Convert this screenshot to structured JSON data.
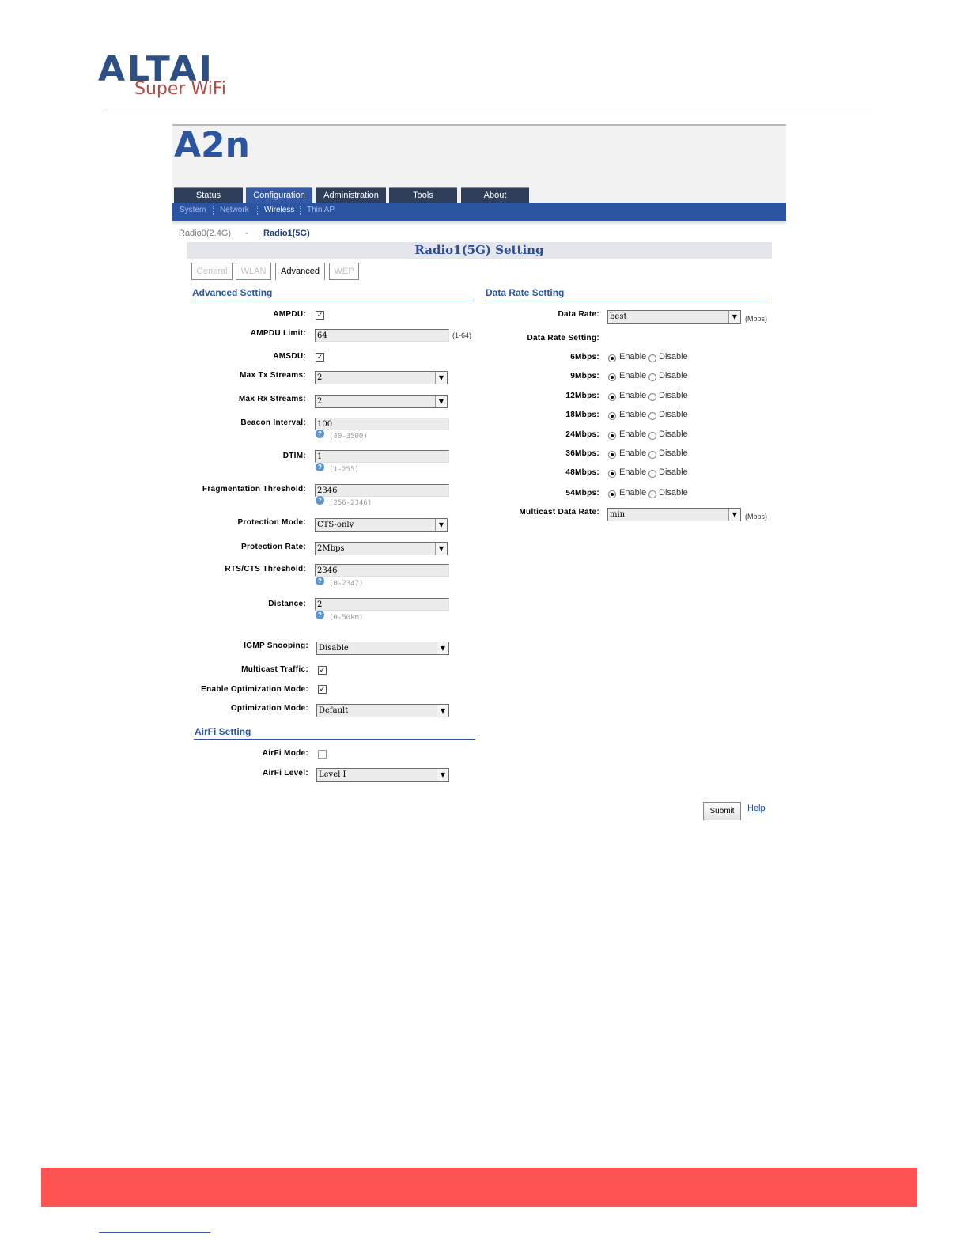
{
  "brand": {
    "logo_text": "ALTAI",
    "tagline": "Super WiFi"
  },
  "device": {
    "model": "A2n"
  },
  "main_nav": [
    {
      "label": "Status"
    },
    {
      "label": "Configuration"
    },
    {
      "label": "Administration"
    },
    {
      "label": "Tools"
    },
    {
      "label": "About"
    }
  ],
  "sub_nav": [
    {
      "label": "System"
    },
    {
      "label": "Network"
    },
    {
      "label": "Wireless"
    },
    {
      "label": "Thin AP"
    }
  ],
  "radio_switch": {
    "radio0": "Radio0(2.4G)",
    "separator": "-",
    "radio1": "Radio1(5G)"
  },
  "page_title": "Radio1(5G) Setting",
  "tabs": [
    {
      "label": "General"
    },
    {
      "label": "WLAN"
    },
    {
      "label": "Advanced"
    },
    {
      "label": "WEP"
    }
  ],
  "advanced": {
    "title": "Advanced Setting",
    "ampdu": {
      "label": "AMPDU:",
      "checked": true
    },
    "ampdu_limit": {
      "label": "AMPDU Limit:",
      "value": "64",
      "range": "(1-64)"
    },
    "amsdu": {
      "label": "AMSDU:",
      "checked": true
    },
    "max_tx": {
      "label": "Max Tx Streams:",
      "value": "2"
    },
    "max_rx": {
      "label": "Max Rx Streams:",
      "value": "2"
    },
    "beacon": {
      "label": "Beacon Interval:",
      "value": "100",
      "range": "(40-3500)"
    },
    "dtim": {
      "label": "DTIM:",
      "value": "1",
      "range": "(1-255)"
    },
    "frag": {
      "label": "Fragmentation Threshold:",
      "value": "2346",
      "range": "(256-2346)"
    },
    "prot_mode": {
      "label": "Protection Mode:",
      "value": "CTS-only"
    },
    "prot_rate": {
      "label": "Protection Rate:",
      "value": "2Mbps"
    },
    "rts": {
      "label": "RTS/CTS Threshold:",
      "value": "2346",
      "range": "(0-2347)"
    },
    "distance": {
      "label": "Distance:",
      "value": "2",
      "range": "(0-50km)"
    },
    "igmp": {
      "label": "IGMP Snooping:",
      "value": "Disable"
    },
    "mcast": {
      "label": "Multicast Traffic:",
      "checked": true
    },
    "opt_enable": {
      "label": "Enable Optimization Mode:",
      "checked": true
    },
    "opt_mode": {
      "label": "Optimization Mode:",
      "value": "Default"
    }
  },
  "airfi": {
    "title": "AirFi Setting",
    "mode": {
      "label": "AirFi Mode:",
      "checked": false
    },
    "level": {
      "label": "AirFi Level:",
      "value": "Level I"
    }
  },
  "datarate": {
    "title": "Data Rate Setting",
    "rate": {
      "label": "Data Rate:",
      "value": "best",
      "unit": "(Mbps)"
    },
    "setting_label": "Data Rate Setting:",
    "enable_text": "Enable",
    "disable_text": "Disable",
    "rates": [
      {
        "label": "6Mbps:",
        "enabled": true
      },
      {
        "label": "9Mbps:",
        "enabled": true
      },
      {
        "label": "12Mbps:",
        "enabled": true
      },
      {
        "label": "18Mbps:",
        "enabled": true
      },
      {
        "label": "24Mbps:",
        "enabled": true
      },
      {
        "label": "36Mbps:",
        "enabled": true
      },
      {
        "label": "48Mbps:",
        "enabled": true
      },
      {
        "label": "54Mbps:",
        "enabled": true
      }
    ],
    "multicast": {
      "label": "Multicast Data Rate:",
      "value": "min",
      "unit": "(Mbps)"
    }
  },
  "actions": {
    "submit": "Submit",
    "help": "Help"
  },
  "help_icon": "question-icon",
  "colors": {
    "brand_blue": "#2b54a3",
    "nav_dark": "#2e3e58",
    "footer_red": "#ff5252",
    "title_blue": "#2b4f9a"
  }
}
